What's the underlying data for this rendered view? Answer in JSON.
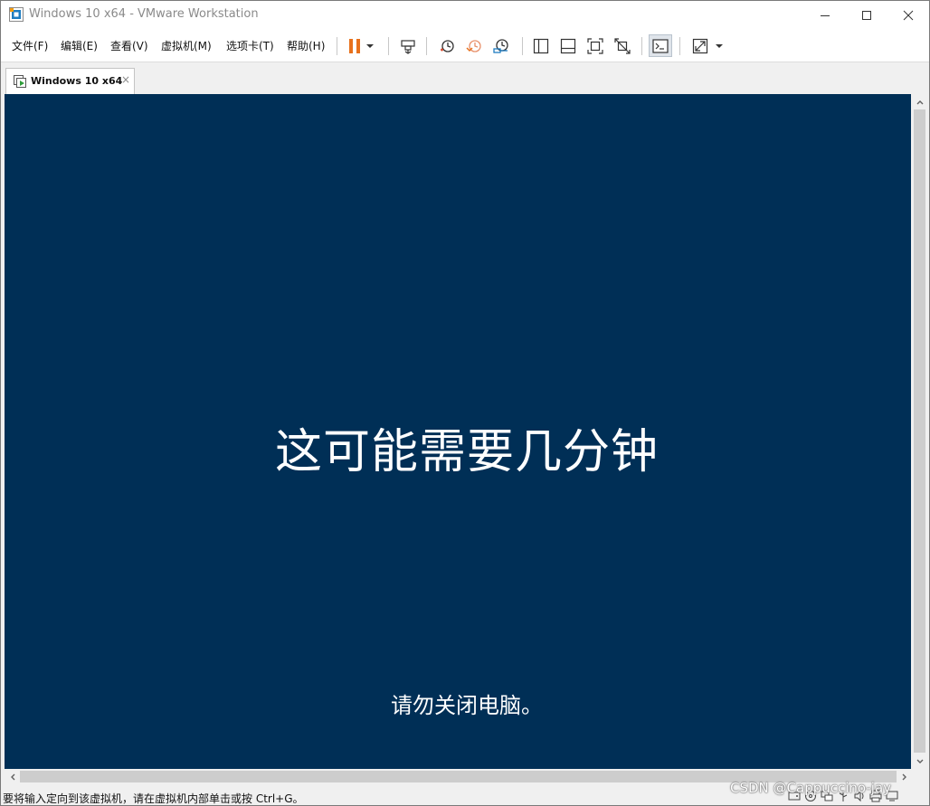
{
  "window": {
    "title": "Windows 10 x64 - VMware Workstation"
  },
  "menu": {
    "items": [
      {
        "label": "文件(F)"
      },
      {
        "label": "编辑(E)"
      },
      {
        "label": "查看(V)"
      },
      {
        "label": "虚拟机(M)"
      },
      {
        "label": "选项卡(T)"
      },
      {
        "label": "帮助(H)"
      }
    ]
  },
  "toolbar": {
    "icons": [
      "pause-icon",
      "dropdown-arrow-icon",
      "send-ctrl-alt-del-icon",
      "snapshot-take-icon",
      "snapshot-revert-icon",
      "snapshot-manager-icon",
      "sidebar-icon",
      "thumbnail-bar-icon",
      "full-screen-icon",
      "unity-icon",
      "console-view-icon",
      "stretch-view-icon"
    ],
    "accent_color": "#e8711c"
  },
  "tabs": [
    {
      "label": "Windows 10 x64",
      "close": "×"
    }
  ],
  "vm": {
    "main_text": "这可能需要几分钟",
    "sub_text": "请勿关闭电脑。",
    "background_color": "#002f56"
  },
  "status": {
    "text": "要将输入定向到该虚拟机，请在虚拟机内部单击或按 Ctrl+G。",
    "icons": [
      "hard-disk-icon",
      "cd-rom-icon",
      "network-icon",
      "usb-icon",
      "sound-icon",
      "printer-icon",
      "display-icon"
    ]
  },
  "watermark": {
    "text": "CSDN @Cappuccino-jay"
  }
}
